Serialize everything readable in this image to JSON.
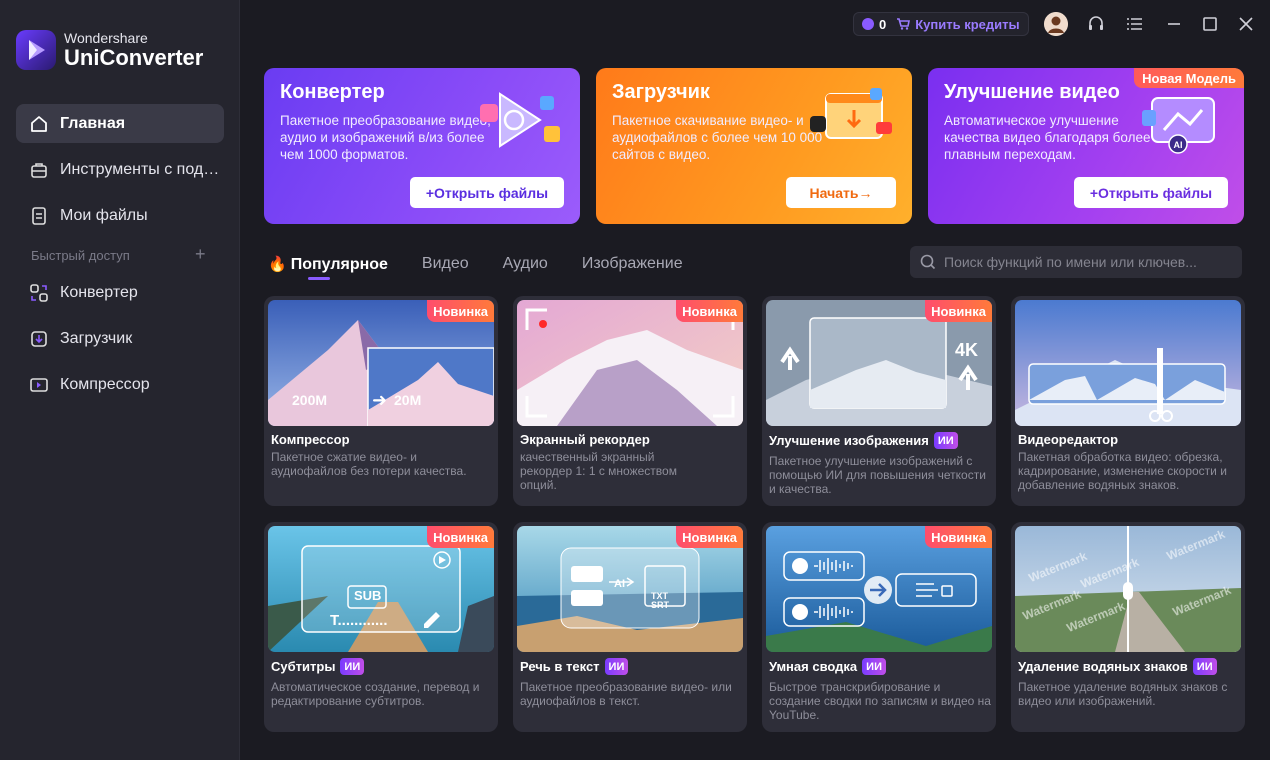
{
  "brand": {
    "top": "Wondershare",
    "bottom": "UniConverter"
  },
  "nav": {
    "items": [
      {
        "label": "Главная",
        "icon": "home-icon"
      },
      {
        "label": "Инструменты с под…",
        "icon": "toolbox-icon"
      },
      {
        "label": "Мои файлы",
        "icon": "files-icon"
      }
    ],
    "quick_access_label": "Быстрый доступ",
    "quick_items": [
      {
        "label": "Конвертер",
        "icon": "converter-icon"
      },
      {
        "label": "Загрузчик",
        "icon": "download-icon"
      },
      {
        "label": "Компрессор",
        "icon": "compress-icon"
      }
    ]
  },
  "topbar": {
    "credits": "0",
    "buy_label": "Купить кредиты"
  },
  "banners": [
    {
      "title": "Конвертер",
      "desc": "Пакетное преобразование видео, аудио и изображений в/из более чем 1000 форматов.",
      "button": "+Открыть файлы"
    },
    {
      "title": "Загрузчик",
      "desc": "Пакетное скачивание видео- и аудиофайлов с более чем 10 000 сайтов с видео.",
      "button": "Начать→"
    },
    {
      "title": "Улучшение видео",
      "desc": "Автоматическое улучшение качества видео благодаря более плавным переходам.",
      "button": "+Открыть файлы",
      "badge": "Новая Модель"
    }
  ],
  "tabs": [
    "Популярное",
    "Видео",
    "Аудио",
    "Изображение"
  ],
  "search": {
    "placeholder": "Поиск функций по имени или ключев..."
  },
  "badges": {
    "new": "Новинка",
    "ai": "ИИ"
  },
  "cards": [
    {
      "title": "Компрессор",
      "desc": "Пакетное сжатие видео- и аудиофайлов без потери качества.",
      "new": true,
      "ai": false,
      "size_from": "200M",
      "size_to": "20M"
    },
    {
      "title": "Экранный рекордер",
      "desc": "качественный экранный рекордер 1: 1 с множеством опций.",
      "new": true,
      "ai": false
    },
    {
      "title": "Улучшение изображения",
      "desc": "Пакетное улучшение изображений с помощью ИИ для повышения четкости и качества.",
      "new": true,
      "ai": true,
      "res": "4K"
    },
    {
      "title": "Видеоредактор",
      "desc": "Пакетная обработка видео: обрезка, кадрирование, изменение скорости и добавление водяных знаков.",
      "new": false,
      "ai": false
    },
    {
      "title": "Субтитры",
      "desc": "Автоматическое создание, перевод и редактирование субтитров.",
      "new": true,
      "ai": true,
      "sub_tag": "SUB",
      "sub_text": "T............"
    },
    {
      "title": "Речь в текст",
      "desc": "Пакетное преобразование видео- или аудиофайлов в текст.",
      "new": true,
      "ai": true,
      "ai_tag": "AI",
      "formats": "TXT SRT"
    },
    {
      "title": "Умная сводка",
      "desc": "Быстрое транскрибирование и создание сводки по записям и видео на YouTube.",
      "new": true,
      "ai": true
    },
    {
      "title": "Удаление водяных знаков",
      "desc": "Пакетное удаление водяных знаков с видео или изображений.",
      "new": false,
      "ai": true,
      "watermark": "Watermark"
    }
  ],
  "colors": {
    "accent": "#8a5bff",
    "sidebar": "#25252e",
    "background": "#1b1b22",
    "card": "#2e2e39"
  }
}
